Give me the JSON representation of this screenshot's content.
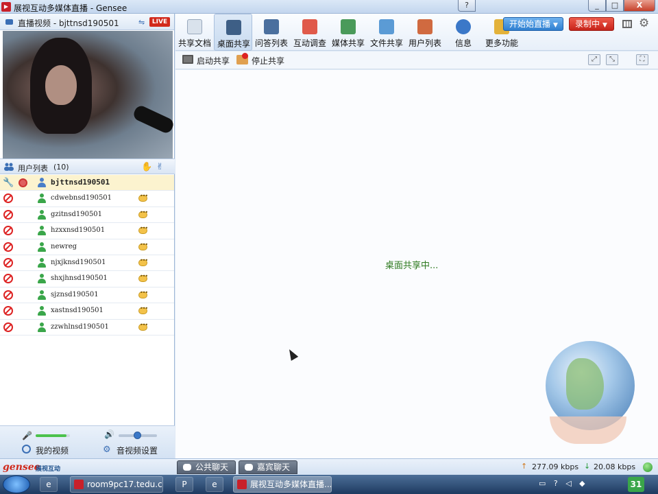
{
  "window": {
    "title": "展视互动多媒体直播 - Gensee",
    "help_symbol": "?",
    "min_symbol": "_",
    "max_symbol": "□",
    "close_symbol": "X"
  },
  "video_panel": {
    "title": "直播视频 - bjttnsd190501",
    "live_badge": "LIVE"
  },
  "user_list": {
    "title": "用户列表",
    "count": "(10)",
    "users": [
      {
        "name": "bjttnsd190501",
        "selected": true
      },
      {
        "name": "cdwebnsd190501"
      },
      {
        "name": "gzitnsd190501"
      },
      {
        "name": "hzxxnsd190501"
      },
      {
        "name": "newreg"
      },
      {
        "name": "njxjknsd190501"
      },
      {
        "name": "shxjhnsd190501"
      },
      {
        "name": "sjznsd190501"
      },
      {
        "name": "xastnsd190501"
      },
      {
        "name": "zzwhlnsd190501"
      }
    ]
  },
  "left_footer": {
    "mic_level": 0.9,
    "volume_level": 0.5,
    "my_video_label": "我的视频",
    "av_settings_label": "音视频设置"
  },
  "toolbar": {
    "tools": [
      {
        "label": "共享文档",
        "icon": "shared-doc-icon",
        "color": "#d9e2ec"
      },
      {
        "label": "桌面共享",
        "icon": "desktop-share-icon",
        "color": "#3e5f86",
        "active": true
      },
      {
        "label": "问答列表",
        "icon": "qa-list-icon",
        "color": "#4a6f9e"
      },
      {
        "label": "互动调查",
        "icon": "survey-icon",
        "color": "#e05a4a"
      },
      {
        "label": "媒体共享",
        "icon": "media-share-icon",
        "color": "#4a9a5a"
      },
      {
        "label": "文件共享",
        "icon": "file-share-icon",
        "color": "#5b9bd5"
      },
      {
        "label": "用户列表",
        "icon": "user-list-icon",
        "color": "#d06a40"
      },
      {
        "label": "信息",
        "icon": "info-icon",
        "color": "#3b78c8"
      },
      {
        "label": "更多功能",
        "icon": "more-functions-icon",
        "color": "#e3b23a"
      }
    ],
    "start_live_label": "开始始直播",
    "record_label": "录制中",
    "caret": "▼",
    "gear_symbol": "⚙"
  },
  "subbar": {
    "start_share_label": "启动共享",
    "stop_share_label": "停止共享",
    "fit_symbol": "⤢",
    "actual_symbol": "⤡",
    "fullscreen_symbol": "⛶"
  },
  "content": {
    "status_text": "桌面共享中..."
  },
  "statusbar": {
    "brand": "gensee",
    "brand_sub": "展视互动",
    "public_chat_label": "公共聊天",
    "guest_chat_label": "嘉宾聊天",
    "upload_rate": "277.09 kbps",
    "download_rate": "20.08 kbps",
    "upload_arrow": "↑",
    "download_arrow": "↓"
  },
  "taskbar": {
    "items": [
      {
        "label": "room9pc17.tedu.c..."
      },
      {
        "label": "展视互动多媒体直播..."
      }
    ],
    "pin1": "e",
    "pin2": "P",
    "pin3": "e",
    "tray": "▭ ? ◁ ◆",
    "clock": "31"
  },
  "colors": {
    "accent": "#3b78c8",
    "live_red": "#d22a1c",
    "status_green": "#2e7a1f"
  }
}
